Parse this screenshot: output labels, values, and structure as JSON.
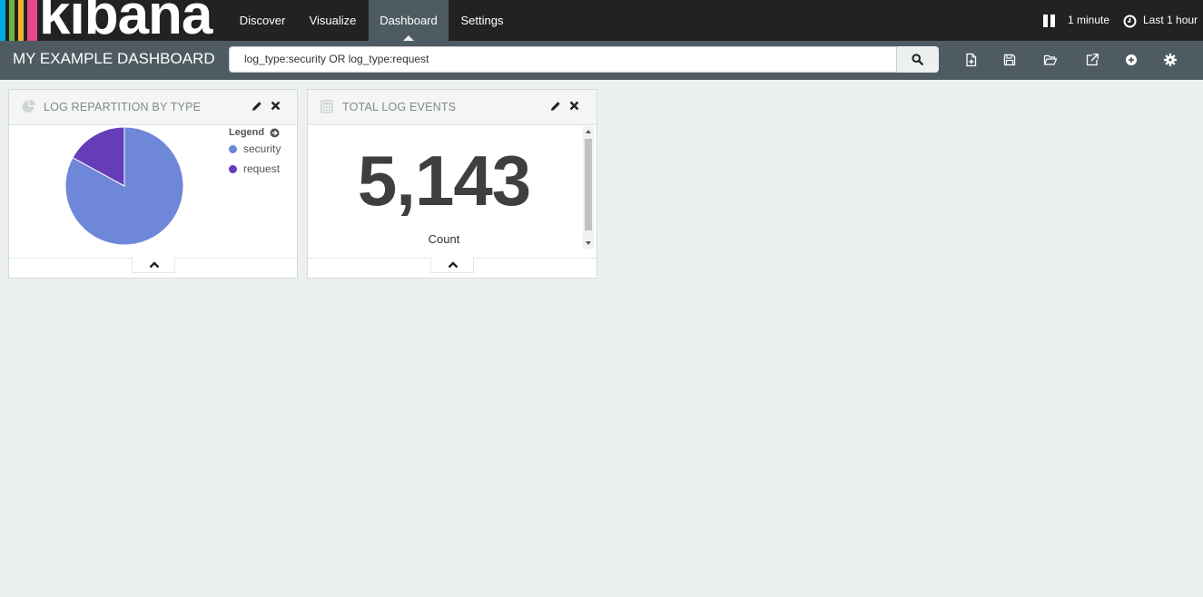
{
  "brand": {
    "logo_text": "kibana",
    "stripe_colors": [
      "#00a9e0",
      "#6eb43f",
      "#f2b134",
      "#e8478b"
    ]
  },
  "nav": {
    "tabs": [
      {
        "label": "Discover",
        "active": false
      },
      {
        "label": "Visualize",
        "active": false
      },
      {
        "label": "Dashboard",
        "active": true
      },
      {
        "label": "Settings",
        "active": false
      }
    ],
    "refresh_interval": "1 minute",
    "time_range": "Last 1 hour"
  },
  "dashboard": {
    "title": "MY EXAMPLE DASHBOARD",
    "query": "log_type:security OR log_type:request",
    "toolbar_icons": [
      "new-dashboard-icon",
      "save-icon",
      "open-folder-icon",
      "share-icon",
      "add-panel-icon",
      "gear-icon"
    ]
  },
  "panels": {
    "pie": {
      "title": "LOG REPARTITION BY TYPE",
      "legend_title": "Legend",
      "legend": [
        {
          "label": "security",
          "color": "#6f87d8"
        },
        {
          "label": "request",
          "color": "#663db8"
        }
      ]
    },
    "metric": {
      "title": "TOTAL LOG EVENTS",
      "value": "5,143",
      "label": "Count"
    }
  },
  "chart_data": {
    "type": "pie",
    "categories": [
      "security",
      "request"
    ],
    "values": [
      0.83,
      0.17
    ],
    "colors": [
      "#6f87d8",
      "#663db8"
    ],
    "legend_position": "top-right"
  }
}
